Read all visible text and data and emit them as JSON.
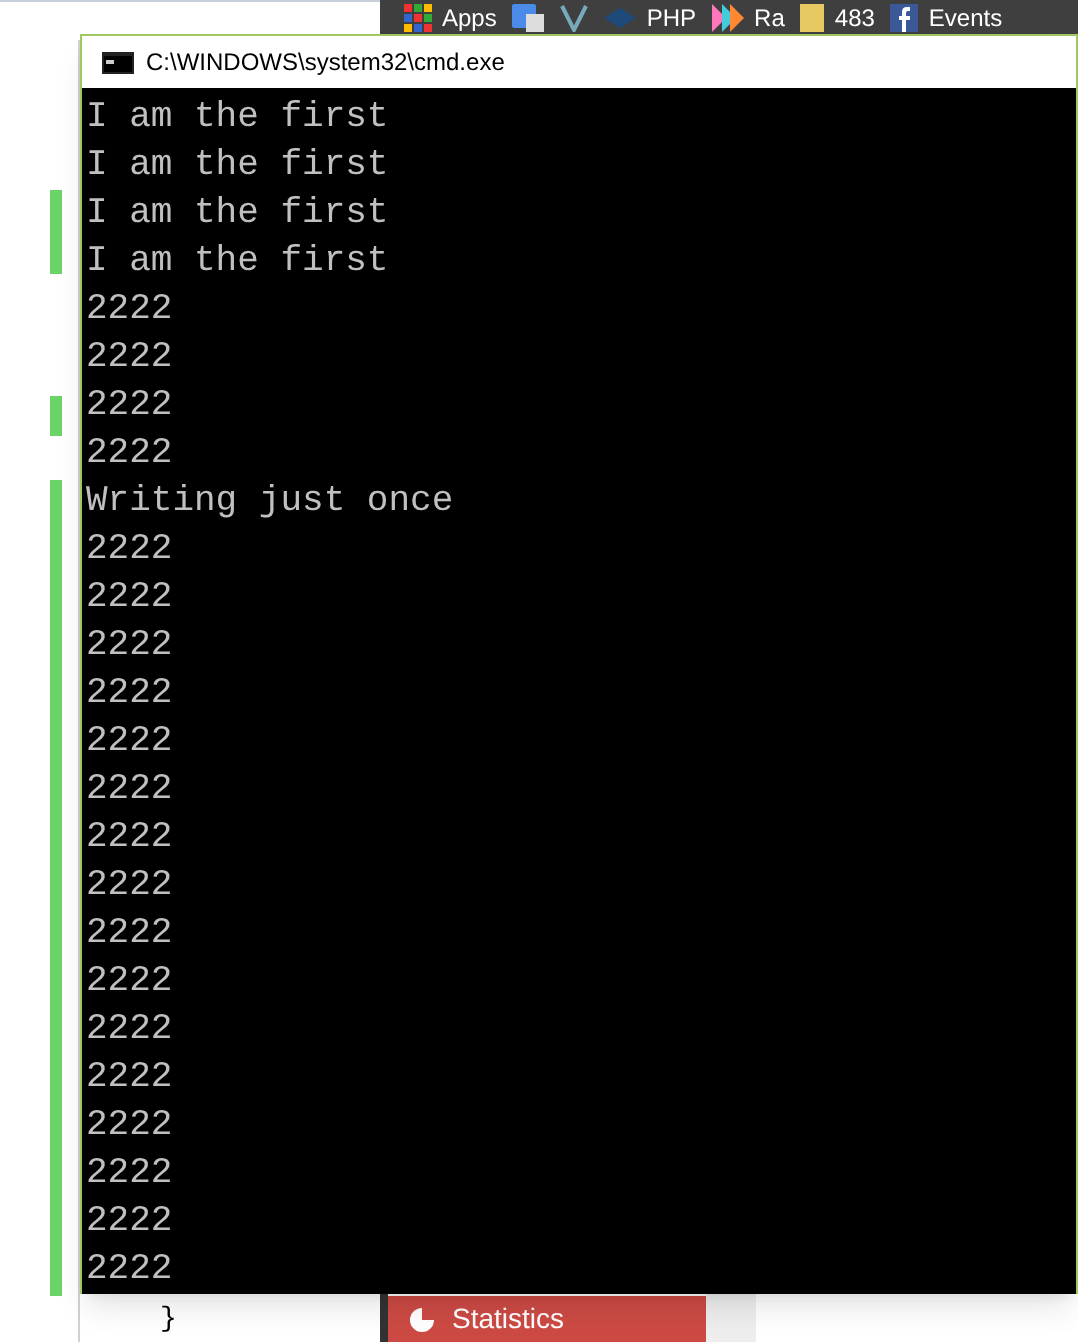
{
  "bookmarks": [
    {
      "label": "Apps",
      "kind": "grid"
    },
    {
      "kind": "translate"
    },
    {
      "kind": "vee"
    },
    {
      "label": "PHP",
      "kind": "diamond"
    },
    {
      "label": "Ra",
      "kind": "arrows"
    },
    {
      "label": "483",
      "kind": "folder"
    },
    {
      "label": "Events",
      "kind": "fb"
    }
  ],
  "editor": {
    "closing_brace": "}"
  },
  "taskbar_button": {
    "label": "Statistics"
  },
  "console": {
    "title": "C:\\WINDOWS\\system32\\cmd.exe",
    "lines": [
      "I am the first",
      "I am the first",
      "I am the first",
      "I am the first",
      "2222",
      "2222",
      "2222",
      "2222",
      "Writing just once",
      "2222",
      "2222",
      "2222",
      "2222",
      "2222",
      "2222",
      "2222",
      "2222",
      "2222",
      "2222",
      "2222",
      "2222",
      "2222",
      "2222",
      "2222",
      "2222"
    ]
  }
}
